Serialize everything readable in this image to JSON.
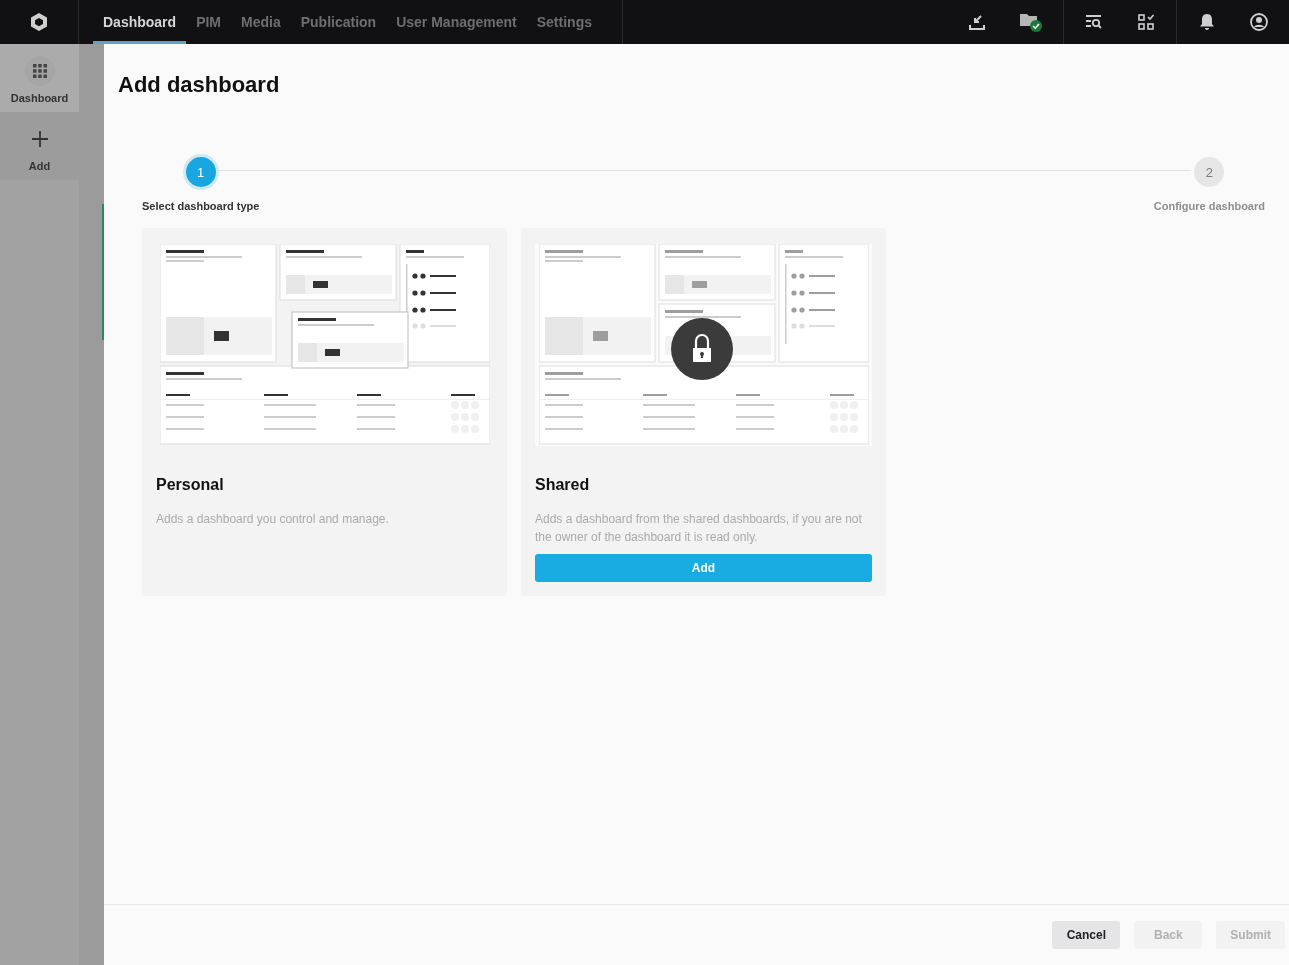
{
  "nav": {
    "tabs": [
      {
        "label": "Dashboard",
        "selected": true
      },
      {
        "label": "PIM",
        "selected": false
      },
      {
        "label": "Media",
        "selected": false
      },
      {
        "label": "Publication",
        "selected": false
      },
      {
        "label": "User Management",
        "selected": false
      },
      {
        "label": "Settings",
        "selected": false
      }
    ]
  },
  "sidebar": {
    "items": [
      {
        "label": "Dashboard",
        "kind": "grid",
        "selected": true
      },
      {
        "label": "Add",
        "kind": "plus",
        "selected": false
      }
    ]
  },
  "page": {
    "title": "Add dashboard"
  },
  "stepper": {
    "steps": [
      {
        "number": "1",
        "label": "Select dashboard type",
        "selected": true
      },
      {
        "number": "2",
        "label": "Configure dashboard",
        "selected": false
      }
    ]
  },
  "cards": [
    {
      "title": "Personal",
      "description": "Adds a dashboard you control and manage.",
      "locked": false
    },
    {
      "title": "Shared",
      "description": "Adds a dashboard from the shared dashboards, if you are not the owner of the dashboard it is read only.",
      "locked": true,
      "button": "Add"
    }
  ],
  "footer": {
    "buttons": [
      {
        "label": "Cancel",
        "disabled": false
      },
      {
        "label": "Back",
        "disabled": true
      },
      {
        "label": "Submit",
        "disabled": true
      }
    ]
  }
}
